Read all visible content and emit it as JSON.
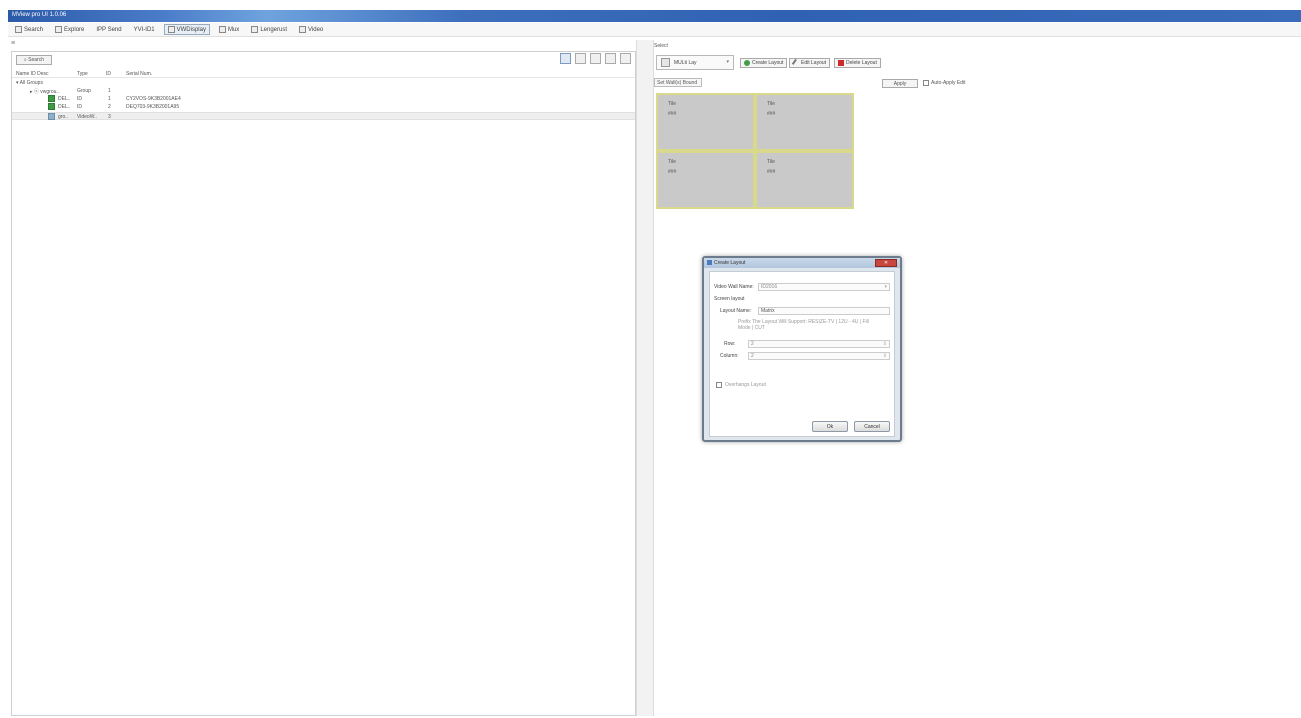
{
  "window": {
    "title": "MView pro UI 1.0.06"
  },
  "toolbar": {
    "items": [
      {
        "label": "Search",
        "icon": "document-icon"
      },
      {
        "label": "Explore",
        "icon": "document-icon"
      },
      {
        "label": "IPP Send",
        "icon": "document-icon"
      },
      {
        "label": "YVI-ID1",
        "icon": "document-icon"
      },
      {
        "label": "VWDisplay",
        "icon": "grid-icon",
        "active": true
      },
      {
        "label": "Mux",
        "icon": "document-icon"
      },
      {
        "label": "Lengerust",
        "icon": "document-icon"
      },
      {
        "label": "Video",
        "icon": "document-icon"
      }
    ]
  },
  "left": {
    "menu_glyph": "≡",
    "search_label": "⌕ Search",
    "columns": {
      "name": "Name ID Desc",
      "type": "Type",
      "id": "ID",
      "serial": "Serial Num."
    },
    "rows": [
      {
        "name": "▾ All Groups",
        "type": "",
        "id": "",
        "serial": ""
      },
      {
        "name": "▸ ⓢ vwgrou..",
        "type": "Group",
        "id": "1",
        "serial": ""
      },
      {
        "name": "DEL..",
        "type": "ID",
        "id": "1",
        "serial": "CY2VOS-9K3B2001AE4",
        "icon": "green"
      },
      {
        "name": "DEL..",
        "type": "ID",
        "id": "2",
        "serial": "DEQ703-9K3B2001A95",
        "icon": "green"
      },
      {
        "name": "gro..",
        "type": "VideoW..",
        "id": "3",
        "serial": "",
        "icon": "grey",
        "selected": true
      }
    ]
  },
  "right": {
    "section_label": "Select",
    "layout_selected": "MULti Lay",
    "create_label": "Create Layout",
    "edit_label": "Edit Layout",
    "delete_label": "Delete Layout",
    "monitor_bound_label": "Set Wall(s) Bound",
    "apply_label": "Apply",
    "auto_apply_label": "Auto-Apply Edit",
    "tiles": [
      {
        "line1": "Tile",
        "line2": "###"
      },
      {
        "line1": "Tile",
        "line2": "###"
      },
      {
        "line1": "Tile",
        "line2": "###"
      },
      {
        "line1": "Tile",
        "line2": "###"
      }
    ]
  },
  "dialog": {
    "title": "Create Layout",
    "close_label": "✕",
    "video_wall_label": "Video Wall Name:",
    "video_wall_value": "ID2016",
    "screen_layout_label": "Screen layout",
    "layout_name_label": "Layout Name:",
    "layout_name_value": "Matrix",
    "hint": "Prefix The Layout Will Support: RESIZE-TV | 12U - 4U | Fill Mode | CUT",
    "rows_label": "Row:",
    "rows_value": "2",
    "cols_label": "Column:",
    "cols_value": "2",
    "check_label": "Overhangs Layout",
    "ok_label": "Ok",
    "cancel_label": "Cancel"
  }
}
